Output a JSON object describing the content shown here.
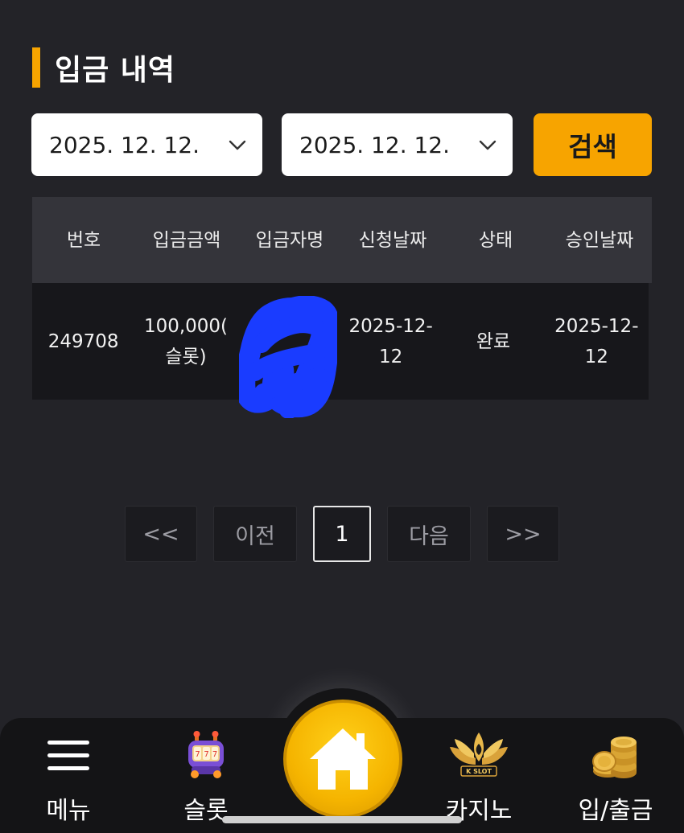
{
  "page": {
    "title": "입금 내역"
  },
  "filter": {
    "start_date": "2025. 12. 12.",
    "end_date": "2025. 12. 12.",
    "search_label": "검색"
  },
  "table": {
    "headers": [
      "번호",
      "입금금액",
      "입금자명",
      "신청날짜",
      "상태",
      "승인날짜"
    ],
    "rows": [
      {
        "number": "249708",
        "amount_line1": "100,000(",
        "amount_line2": "슬롯)",
        "depositor": "",
        "request_date_line1": "2025-12-",
        "request_date_line2": "12",
        "status": "완료",
        "approve_date_line1": "2025-12-",
        "approve_date_line2": "12"
      }
    ]
  },
  "pagination": {
    "first": "<<",
    "prev": "이전",
    "current": "1",
    "next": "다음",
    "last": ">>"
  },
  "bottom_nav": {
    "menu": "메뉴",
    "slot": "슬롯",
    "casino": "카지노",
    "casino_logo_text": "K SLOT",
    "deposit": "입/출금"
  },
  "colors": {
    "background": "#232328",
    "accent": "#f7a400",
    "redaction": "#1a3cff"
  }
}
